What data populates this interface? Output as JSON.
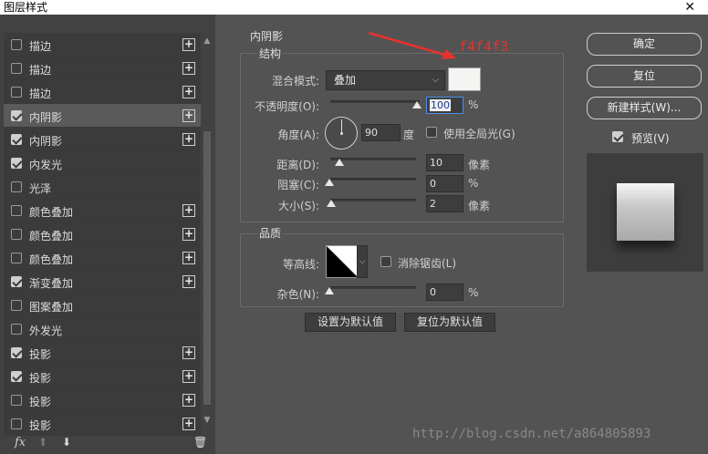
{
  "window": {
    "title": "图层样式",
    "close_glyph": "✕"
  },
  "left_panel": {
    "items": [
      {
        "label": "描边",
        "checked": false,
        "has_plus": true
      },
      {
        "label": "描边",
        "checked": false,
        "has_plus": true
      },
      {
        "label": "描边",
        "checked": false,
        "has_plus": true
      },
      {
        "label": "内阴影",
        "checked": true,
        "has_plus": true,
        "selected": true
      },
      {
        "label": "内阴影",
        "checked": true,
        "has_plus": true
      },
      {
        "label": "内发光",
        "checked": true,
        "has_plus": false
      },
      {
        "label": "光泽",
        "checked": false,
        "has_plus": false
      },
      {
        "label": "颜色叠加",
        "checked": false,
        "has_plus": true
      },
      {
        "label": "颜色叠加",
        "checked": false,
        "has_plus": true
      },
      {
        "label": "颜色叠加",
        "checked": false,
        "has_plus": true
      },
      {
        "label": "渐变叠加",
        "checked": true,
        "has_plus": true
      },
      {
        "label": "图案叠加",
        "checked": false,
        "has_plus": false
      },
      {
        "label": "外发光",
        "checked": false,
        "has_plus": false
      },
      {
        "label": "投影",
        "checked": true,
        "has_plus": true
      },
      {
        "label": "投影",
        "checked": true,
        "has_plus": true
      },
      {
        "label": "投影",
        "checked": false,
        "has_plus": true
      },
      {
        "label": "投影",
        "checked": false,
        "has_plus": true
      }
    ],
    "plus_glyph": "+",
    "fx_label": "fx",
    "icons": {
      "fx": "fx-icon",
      "up": "move-up-icon",
      "down": "move-down-icon",
      "trash": "trash-icon"
    }
  },
  "inner_shadow": {
    "section_title": "内阴影",
    "structure_title": "结构",
    "blend_mode_label": "混合模式:",
    "blend_mode_value": "叠加",
    "swatch_color": "#f4f4f3",
    "opacity_label": "不透明度(O):",
    "opacity_value": "100",
    "opacity_unit": "%",
    "angle_label": "角度(A):",
    "angle_value": "90",
    "angle_unit": "度",
    "global_light_label": "使用全局光(G)",
    "global_light_checked": false,
    "distance_label": "距离(D):",
    "distance_value": "10",
    "distance_unit": "像素",
    "choke_label": "阻塞(C):",
    "choke_value": "0",
    "choke_unit": "%",
    "size_label": "大小(S):",
    "size_value": "2",
    "size_unit": "像素",
    "quality_title": "品质",
    "contour_label": "等高线:",
    "anti_alias_label": "消除锯齿(L)",
    "anti_alias_checked": false,
    "noise_label": "杂色(N):",
    "noise_value": "0",
    "noise_unit": "%",
    "set_default_label": "设置为默认值",
    "reset_default_label": "复位为默认值"
  },
  "right_panel": {
    "ok_label": "确定",
    "reset_label": "复位",
    "new_style_label": "新建样式(W)...",
    "preview_label": "预览(V)",
    "preview_checked": true
  },
  "annotation": {
    "text": "f4f4f3",
    "color": "#e8322e"
  },
  "watermark": "http://blog.csdn.net/a864805893"
}
